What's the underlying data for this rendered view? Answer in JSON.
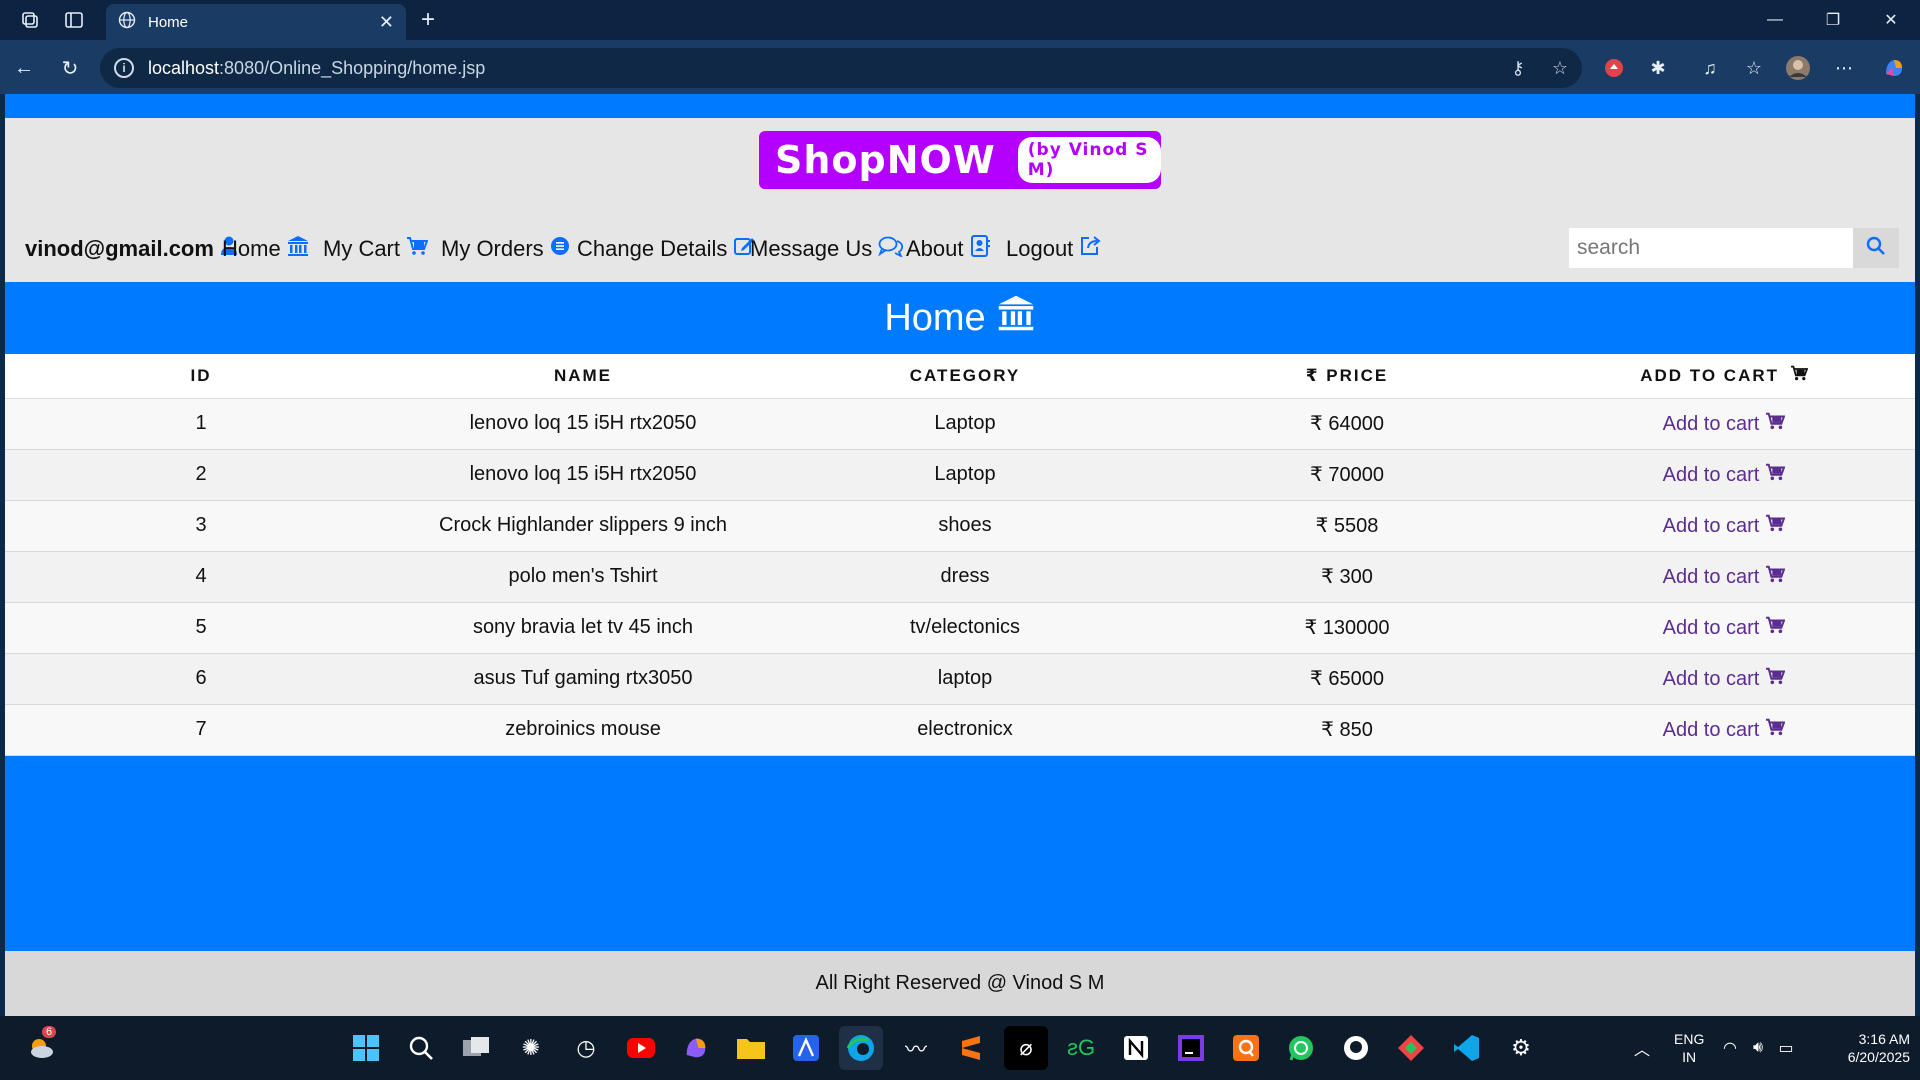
{
  "browser": {
    "tab_title": "Home",
    "url_host": "localhost",
    "url_rest": ":8080/Online_Shopping/home.jsp"
  },
  "brand": {
    "name": "ShopNOW",
    "subtitle": "(by Vinod S M)"
  },
  "nav": {
    "user": "vinod@gmail.com",
    "items": [
      {
        "label": "Home",
        "icon": "bank-icon"
      },
      {
        "label": "My Cart",
        "icon": "cart-icon"
      },
      {
        "label": "My Orders",
        "icon": "list-icon"
      },
      {
        "label": "Change Details",
        "icon": "edit-icon"
      },
      {
        "label": "Message Us",
        "icon": "chat-icon"
      },
      {
        "label": "About",
        "icon": "contact-card-icon"
      },
      {
        "label": "Logout",
        "icon": "external-link-icon"
      }
    ],
    "search_placeholder": "search"
  },
  "page_title": "Home",
  "table": {
    "headers": [
      "ID",
      "NAME",
      "CATEGORY",
      "₹ PRICE",
      "ADD TO CART"
    ],
    "rows": [
      {
        "id": "1",
        "name": "lenovo loq 15 i5H rtx2050",
        "category": "Laptop",
        "price": "₹ 64000",
        "action": "Add to cart"
      },
      {
        "id": "2",
        "name": "lenovo loq 15 i5H rtx2050",
        "category": "Laptop",
        "price": "₹ 70000",
        "action": "Add to cart"
      },
      {
        "id": "3",
        "name": "Crock Highlander slippers 9 inch",
        "category": "shoes",
        "price": "₹ 5508",
        "action": "Add to cart"
      },
      {
        "id": "4",
        "name": "polo men's Tshirt",
        "category": "dress",
        "price": "₹ 300",
        "action": "Add to cart"
      },
      {
        "id": "5",
        "name": "sony bravia let tv 45 inch",
        "category": "tv/electonics",
        "price": "₹ 130000",
        "action": "Add to cart"
      },
      {
        "id": "6",
        "name": "asus Tuf gaming rtx3050",
        "category": "laptop",
        "price": "₹ 65000",
        "action": "Add to cart"
      },
      {
        "id": "7",
        "name": "zebroinics mouse",
        "category": "electronicx",
        "price": "₹ 850",
        "action": "Add to cart"
      }
    ]
  },
  "footer": "All Right Reserved @ Vinod S M",
  "taskbar": {
    "weather_badge": "6",
    "lang_line1": "ENG",
    "lang_line2": "IN",
    "time": "3:16 AM",
    "date": "6/20/2025"
  },
  "colors": {
    "page_blue": "#007bff",
    "brand_purple": "#b300ff",
    "link_purple": "#5b2d90"
  }
}
